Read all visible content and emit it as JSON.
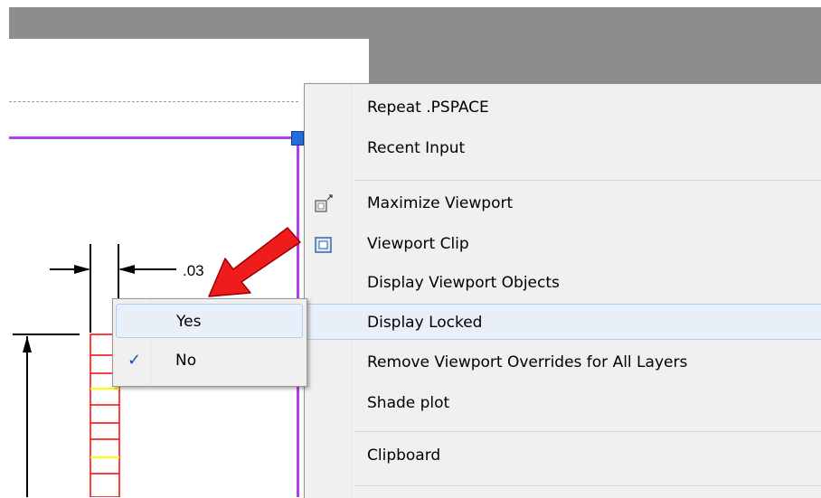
{
  "drawing": {
    "dimension_text": ".03"
  },
  "context_menu": {
    "items": [
      {
        "label": "Repeat .PSPACE",
        "icon": ""
      },
      {
        "label": "Recent Input",
        "icon": ""
      },
      {
        "label": "Maximize Viewport",
        "icon": "maximize-viewport-icon"
      },
      {
        "label": "Viewport Clip",
        "icon": "viewport-clip-icon"
      },
      {
        "label": "Display Viewport Objects",
        "icon": ""
      },
      {
        "label": "Display Locked",
        "icon": "",
        "highlighted": true
      },
      {
        "label": "Remove Viewport Overrides for All Layers",
        "icon": ""
      },
      {
        "label": "Shade plot",
        "icon": ""
      },
      {
        "label": "Clipboard",
        "icon": ""
      }
    ]
  },
  "submenu": {
    "items": [
      {
        "label": "Yes",
        "checked": false,
        "highlighted": true
      },
      {
        "label": "No",
        "checked": true,
        "check_glyph": "✓"
      }
    ]
  },
  "colors": {
    "viewport_border": "#b63cf2",
    "grip": "#1f6fe0",
    "annotation_arrow": "#ee1c1c",
    "drawing_red": "#ff0000",
    "drawing_yellow": "#ffff00"
  }
}
